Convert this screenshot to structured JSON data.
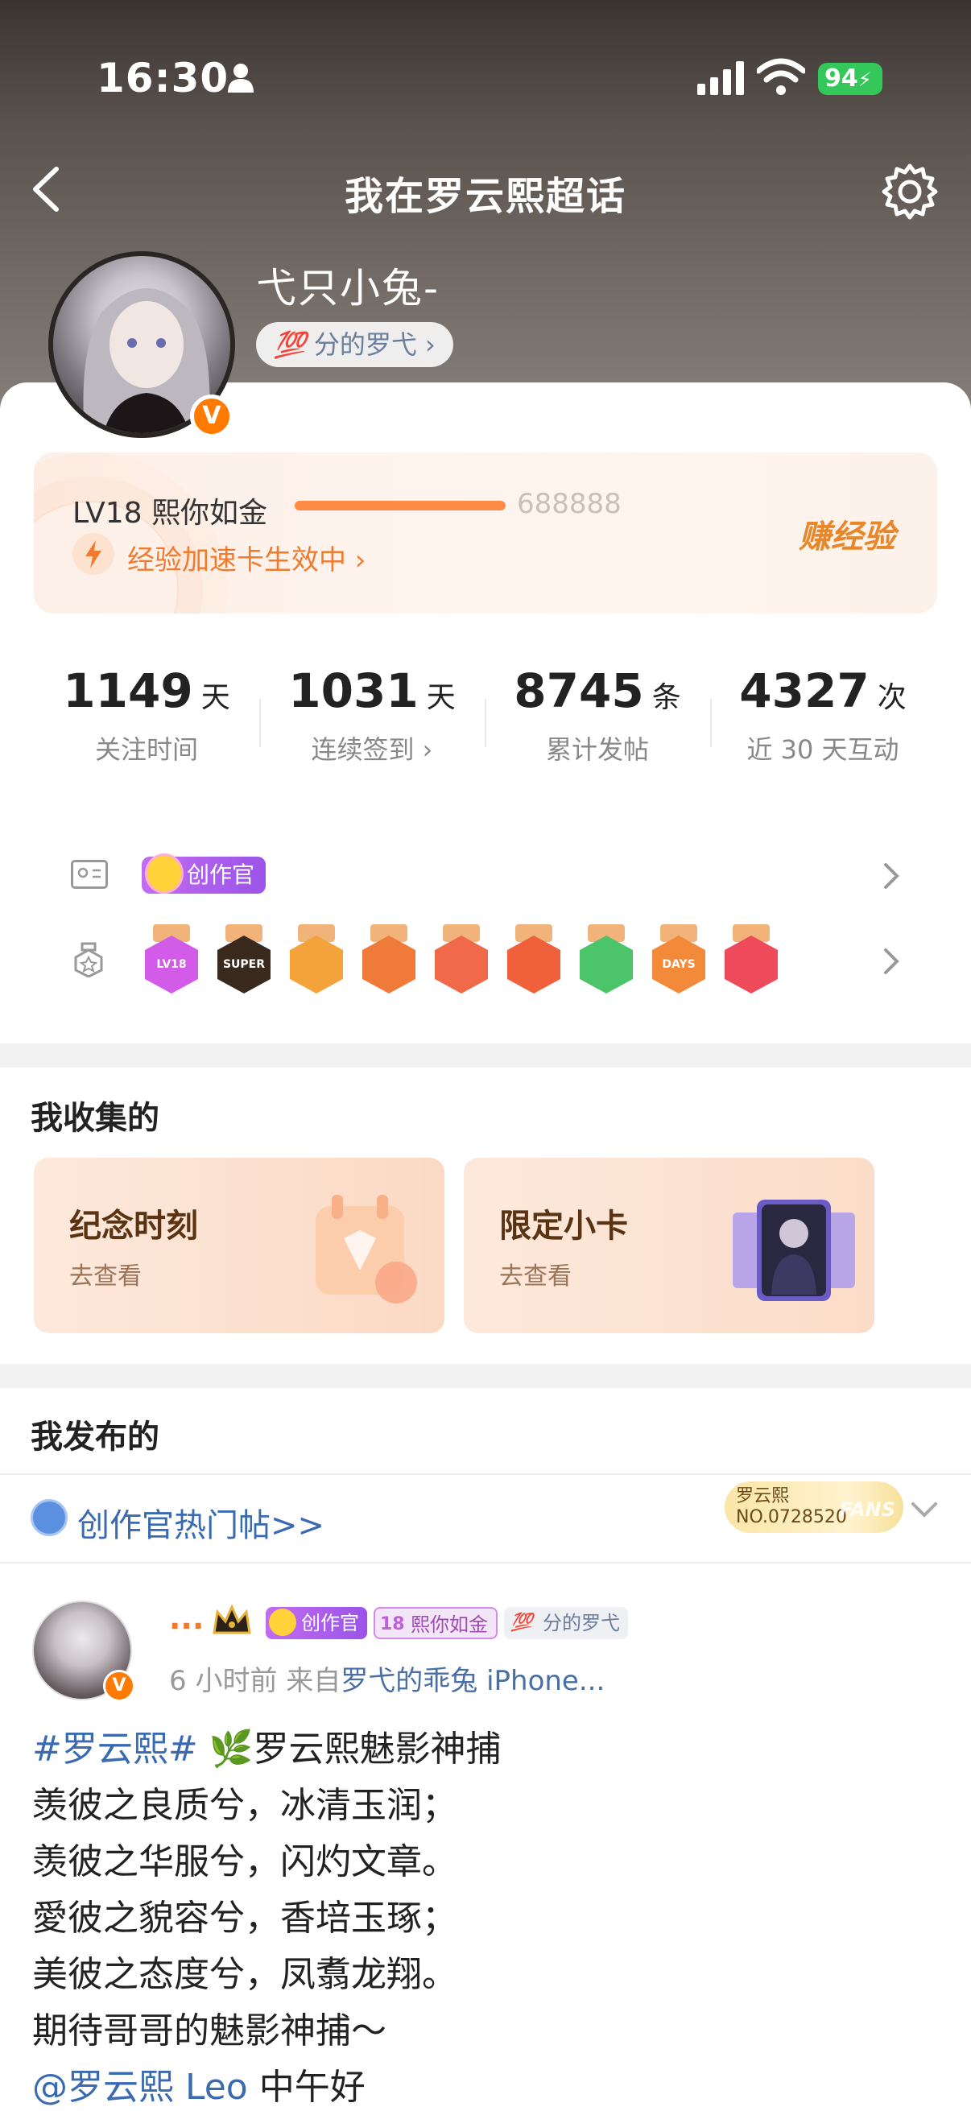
{
  "status_bar": {
    "time": "16:30",
    "battery": "94"
  },
  "nav": {
    "title": "我在罗云熙超话"
  },
  "profile": {
    "username": "弋只小兔-",
    "fan_tag": "分的罗弋",
    "fan_tag_prefix": "💯",
    "verified": "V"
  },
  "level": {
    "name": "LV18 熙你如金",
    "exp": "688888",
    "progress": 1.0,
    "boost": "经验加速卡生效中 ›",
    "earn": "赚经验"
  },
  "stats": [
    {
      "value": "1149",
      "unit": "天",
      "label": "关注时间"
    },
    {
      "value": "1031",
      "unit": "天",
      "label": "连续签到 ›"
    },
    {
      "value": "8745",
      "unit": "条",
      "label": "累计发帖"
    },
    {
      "value": "4327",
      "unit": "次",
      "label": "近 30 天互动"
    }
  ],
  "badges": {
    "creator_tag": "创作官"
  },
  "medals": [
    {
      "label": "LV18",
      "color": "#d25be8"
    },
    {
      "label": "SUPER",
      "color": "#3a2a1e"
    },
    {
      "label": "",
      "color": "#f4a23a"
    },
    {
      "label": "",
      "color": "#f07a3a"
    },
    {
      "label": "",
      "color": "#f06a4a"
    },
    {
      "label": "",
      "color": "#f0603a"
    },
    {
      "label": "",
      "color": "#4cc46a"
    },
    {
      "label": "DAYS",
      "color": "#f28a3a"
    },
    {
      "label": "",
      "color": "#ee4a5a"
    }
  ],
  "collected": {
    "title": "我收集的",
    "items": [
      {
        "title": "纪念时刻",
        "sub": "去查看"
      },
      {
        "title": "限定小卡",
        "sub": "去查看"
      }
    ]
  },
  "published": {
    "title": "我发布的"
  },
  "hot": {
    "label": "创作官热门帖>>",
    "fan_card_name": "罗云熙",
    "fan_card_no": "NO.0728520",
    "fan_card_fans": "FANS"
  },
  "post": {
    "name": "...",
    "tags": [
      "创作官",
      "熙你如金",
      "分的罗弋"
    ],
    "level_num": "18",
    "time": "6 小时前",
    "from_label": "来自",
    "source": "罗弋的乖兔 iPhone...",
    "hashtag": "#罗云熙#",
    "lines": [
      "罗云熙魅影神捕",
      "羡彼之良质兮，冰清玉润；",
      "羡彼之华服兮，闪灼文章。",
      "愛彼之貌容兮，香培玉琢；",
      "美彼之态度兮，凤翥龙翔。",
      "期待哥哥的魅影神捕～"
    ],
    "mention": "@罗云熙 Leo",
    "greeting": "中午好"
  }
}
